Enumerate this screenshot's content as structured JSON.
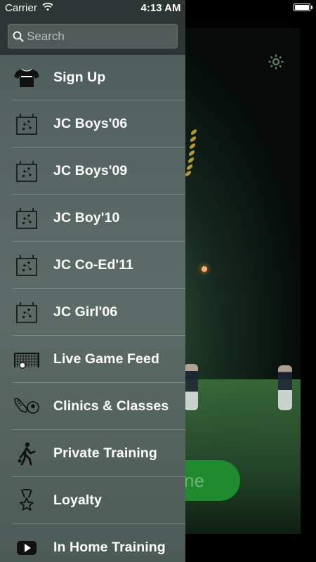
{
  "status_bar": {
    "carrier": "Carrier",
    "time": "4:13 AM"
  },
  "search": {
    "placeholder": "Search"
  },
  "menu": {
    "items": [
      {
        "label": "Sign Up",
        "icon": "jersey-icon"
      },
      {
        "label": "JC Boys'06",
        "icon": "tactics-board-icon"
      },
      {
        "label": "JC Boys'09",
        "icon": "tactics-board-icon"
      },
      {
        "label": "JC Boy'10",
        "icon": "tactics-board-icon"
      },
      {
        "label": "JC Co-Ed'11",
        "icon": "tactics-board-icon"
      },
      {
        "label": "JC Girl'06",
        "icon": "tactics-board-icon"
      },
      {
        "label": "Live Game Feed",
        "icon": "goal-net-icon"
      },
      {
        "label": "Clinics & Classes",
        "icon": "shoe-ball-icon"
      },
      {
        "label": "Private Training",
        "icon": "player-kick-icon"
      },
      {
        "label": "Loyalty",
        "icon": "medal-icon"
      },
      {
        "label": "In Home Training",
        "icon": "video-play-icon"
      }
    ]
  },
  "background": {
    "cta_fragment": "ne"
  },
  "colors": {
    "drawer": "#5a6865",
    "drawer_header": "#2e3635",
    "cta_green": "#1f8a2e",
    "settings_icon": "#5b7d5a"
  }
}
